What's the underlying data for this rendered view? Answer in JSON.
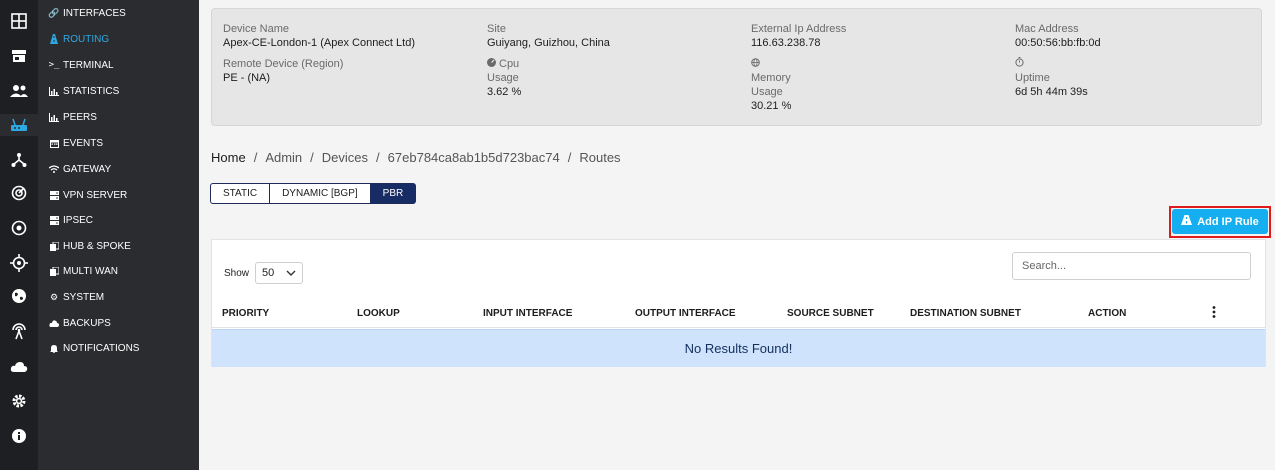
{
  "rail": {
    "items": [
      {
        "icon": "dashboard-grid-icon"
      },
      {
        "icon": "store-icon"
      },
      {
        "icon": "users-icon"
      },
      {
        "icon": "router-icon",
        "active": true
      },
      {
        "icon": "network-fork-icon"
      },
      {
        "icon": "radar-icon"
      },
      {
        "icon": "target-circle-icon"
      },
      {
        "icon": "crosshair-icon"
      },
      {
        "icon": "globe-icon"
      },
      {
        "icon": "antenna-icon"
      },
      {
        "icon": "cloud-icon"
      },
      {
        "icon": "gear-icon"
      },
      {
        "icon": "info-icon"
      }
    ]
  },
  "submenu": {
    "items": [
      {
        "label": "INTERFACES",
        "icon": "link-icon"
      },
      {
        "label": "ROUTING",
        "icon": "routing-icon",
        "active": true
      },
      {
        "label": "TERMINAL",
        "icon": "terminal-icon"
      },
      {
        "label": "STATISTICS",
        "icon": "bar-chart-icon"
      },
      {
        "label": "PEERS",
        "icon": "bar-chart-icon"
      },
      {
        "label": "EVENTS",
        "icon": "calendar-icon"
      },
      {
        "label": "GATEWAY",
        "icon": "wifi-icon"
      },
      {
        "label": "VPN SERVER",
        "icon": "server-icon"
      },
      {
        "label": "IPSEC",
        "icon": "server-icon"
      },
      {
        "label": "HUB & SPOKE",
        "icon": "copy-icon"
      },
      {
        "label": "MULTI WAN",
        "icon": "copy-icon"
      },
      {
        "label": "SYSTEM",
        "icon": "gear-icon"
      },
      {
        "label": "BACKUPS",
        "icon": "cloud-icon"
      },
      {
        "label": "NOTIFICATIONS",
        "icon": "bell-icon"
      }
    ]
  },
  "device": {
    "name_label": "Device Name",
    "name": "Apex-CE-London-1 (Apex Connect Ltd)",
    "remote_label": "Remote Device (Region)",
    "remote": "PE - (NA)",
    "site_label": "Site",
    "site": "Guiyang, Guizhou, China",
    "cpu_label": "Cpu",
    "cpu_usage_label": "Usage",
    "cpu_usage": "3.62 %",
    "ext_ip_label": "External Ip Address",
    "ext_ip": "116.63.238.78",
    "memory_label": "Memory",
    "memory_usage_label": "Usage",
    "memory_usage": "30.21 %",
    "mac_label": "Mac Address",
    "mac": "00:50:56:bb:fb:0d",
    "uptime_label": "Uptime",
    "uptime": "6d 5h 44m 39s"
  },
  "breadcrumb": {
    "items": [
      "Home",
      "Admin",
      "Devices",
      "67eb784ca8ab1b5d723bac74",
      "Routes"
    ],
    "separator": "/"
  },
  "tabs": [
    {
      "label": "STATIC"
    },
    {
      "label": "DYNAMIC [BGP]"
    },
    {
      "label": "PBR",
      "active": true
    }
  ],
  "add_button": {
    "label": "Add IP Rule"
  },
  "table": {
    "show_label": "Show",
    "page_size": "50",
    "search_placeholder": "Search...",
    "columns": [
      "PRIORITY",
      "LOOKUP",
      "INPUT INTERFACE",
      "OUTPUT INTERFACE",
      "SOURCE SUBNET",
      "DESTINATION SUBNET",
      "ACTION"
    ],
    "empty_message": "No Results Found!"
  },
  "colors": {
    "accent": "#15aef0",
    "active_tab": "#172b64",
    "highlight_outline": "#e01b1b",
    "empty_bg": "#cfe3fc"
  }
}
